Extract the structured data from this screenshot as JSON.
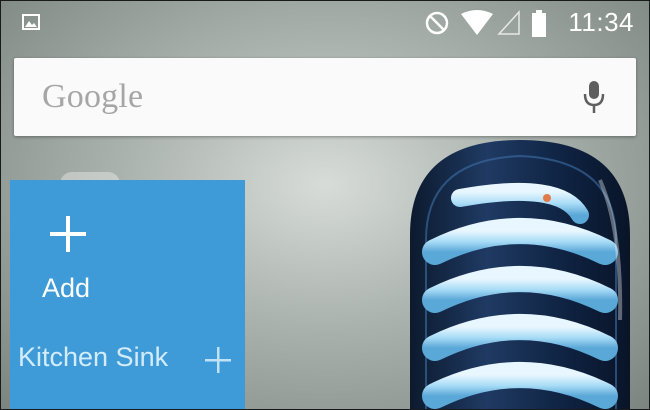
{
  "statusbar": {
    "time": "11:34",
    "icons": [
      "picture-notification-icon",
      "do-not-disturb-icon",
      "wifi-icon",
      "cell-signal-icon",
      "battery-icon"
    ]
  },
  "search": {
    "logo": "Google",
    "mic_icon": "microphone-icon"
  },
  "widget": {
    "add_label": "Add",
    "title": "Kitchen Sink",
    "color": "#3f9bd8"
  },
  "wallpaper": {
    "subject": "lightbulb-illustration"
  }
}
